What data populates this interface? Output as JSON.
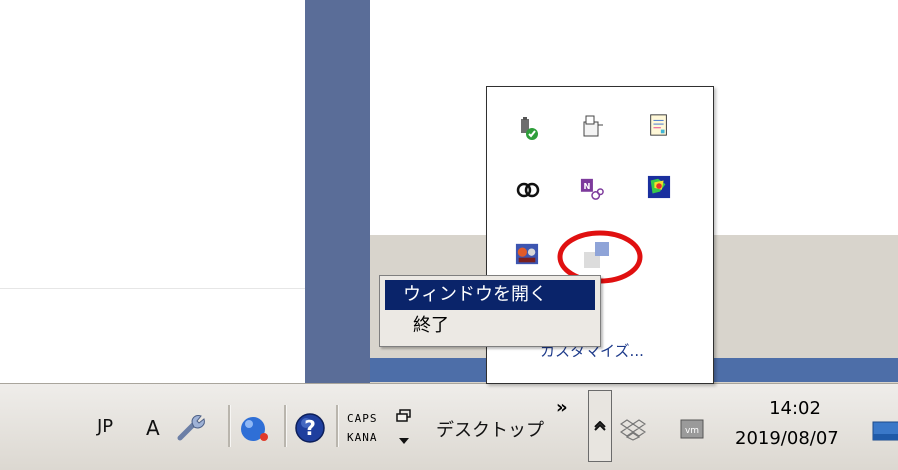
{
  "taskbar": {
    "language": "JP",
    "ime_mode": "A",
    "caps_label": "CAPS",
    "kana_label": "KANA",
    "desktop_label": "デスクトップ",
    "overflow_chevron": "»",
    "tray_expand_glyph": "^",
    "clock_time": "14:02",
    "clock_date": "2019/08/07"
  },
  "context_menu": {
    "items": [
      {
        "label": "ウィンドウを開く",
        "highlighted": true
      },
      {
        "label": "終了",
        "highlighted": false
      }
    ]
  },
  "tray_popup": {
    "icons": [
      "usb-safely-remove-icon",
      "network-device-icon",
      "notepad-icon",
      "creative-cloud-icon",
      "onenote-clipping-icon",
      "colorful-app-icon",
      "teams-icon",
      "selected-app-icon"
    ],
    "customize_label": "カスタマイズ..."
  },
  "colors": {
    "menu_highlight": "#0a246a",
    "annotation_circle": "#e01010",
    "blue_strip": "#5a6d98"
  }
}
